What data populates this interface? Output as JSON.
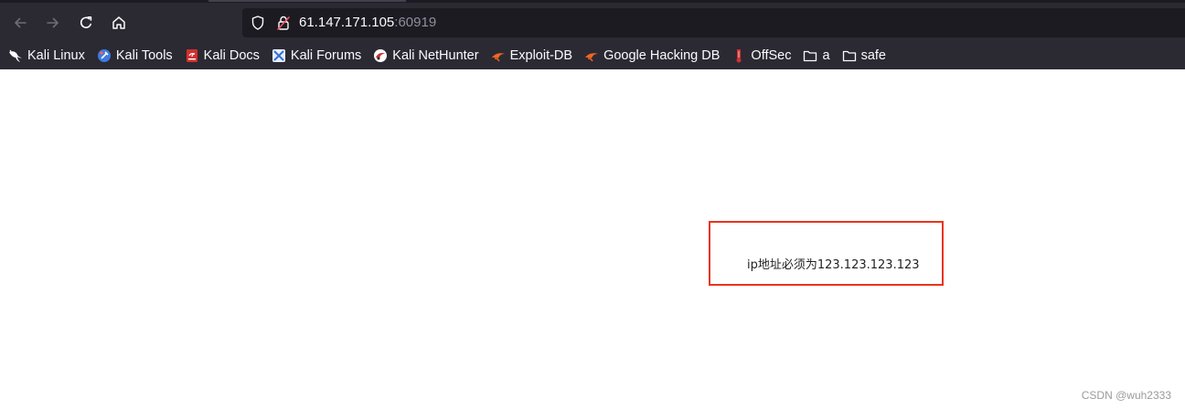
{
  "browser": {
    "url_host": "61.147.171.105",
    "url_port": ":60919",
    "colors": {
      "chrome_bg": "#2b2a33",
      "urlbar_bg": "#1c1b22",
      "text": "#fbfbfe",
      "muted": "#8f8f9d"
    }
  },
  "nav": {
    "back_icon": "arrow-left-icon",
    "forward_icon": "arrow-right-icon",
    "reload_icon": "reload-icon",
    "home_icon": "home-icon"
  },
  "bookmarks": [
    {
      "label": "Kali Linux",
      "icon": "kali-dragon-icon"
    },
    {
      "label": "Kali Tools",
      "icon": "kali-tools-icon"
    },
    {
      "label": "Kali Docs",
      "icon": "kali-docs-icon"
    },
    {
      "label": "Kali Forums",
      "icon": "kali-forums-icon"
    },
    {
      "label": "Kali NetHunter",
      "icon": "kali-nethunter-icon"
    },
    {
      "label": "Exploit-DB",
      "icon": "exploit-db-icon"
    },
    {
      "label": "Google Hacking DB",
      "icon": "ghdb-icon"
    },
    {
      "label": "OffSec",
      "icon": "offsec-icon"
    },
    {
      "label": "a",
      "icon": "folder-icon"
    },
    {
      "label": "safe",
      "icon": "folder-icon"
    }
  ],
  "page": {
    "message": "ip地址必须为123.123.123.123",
    "highlight_color": "#e8341c"
  },
  "watermark": "CSDN @wuh2333"
}
